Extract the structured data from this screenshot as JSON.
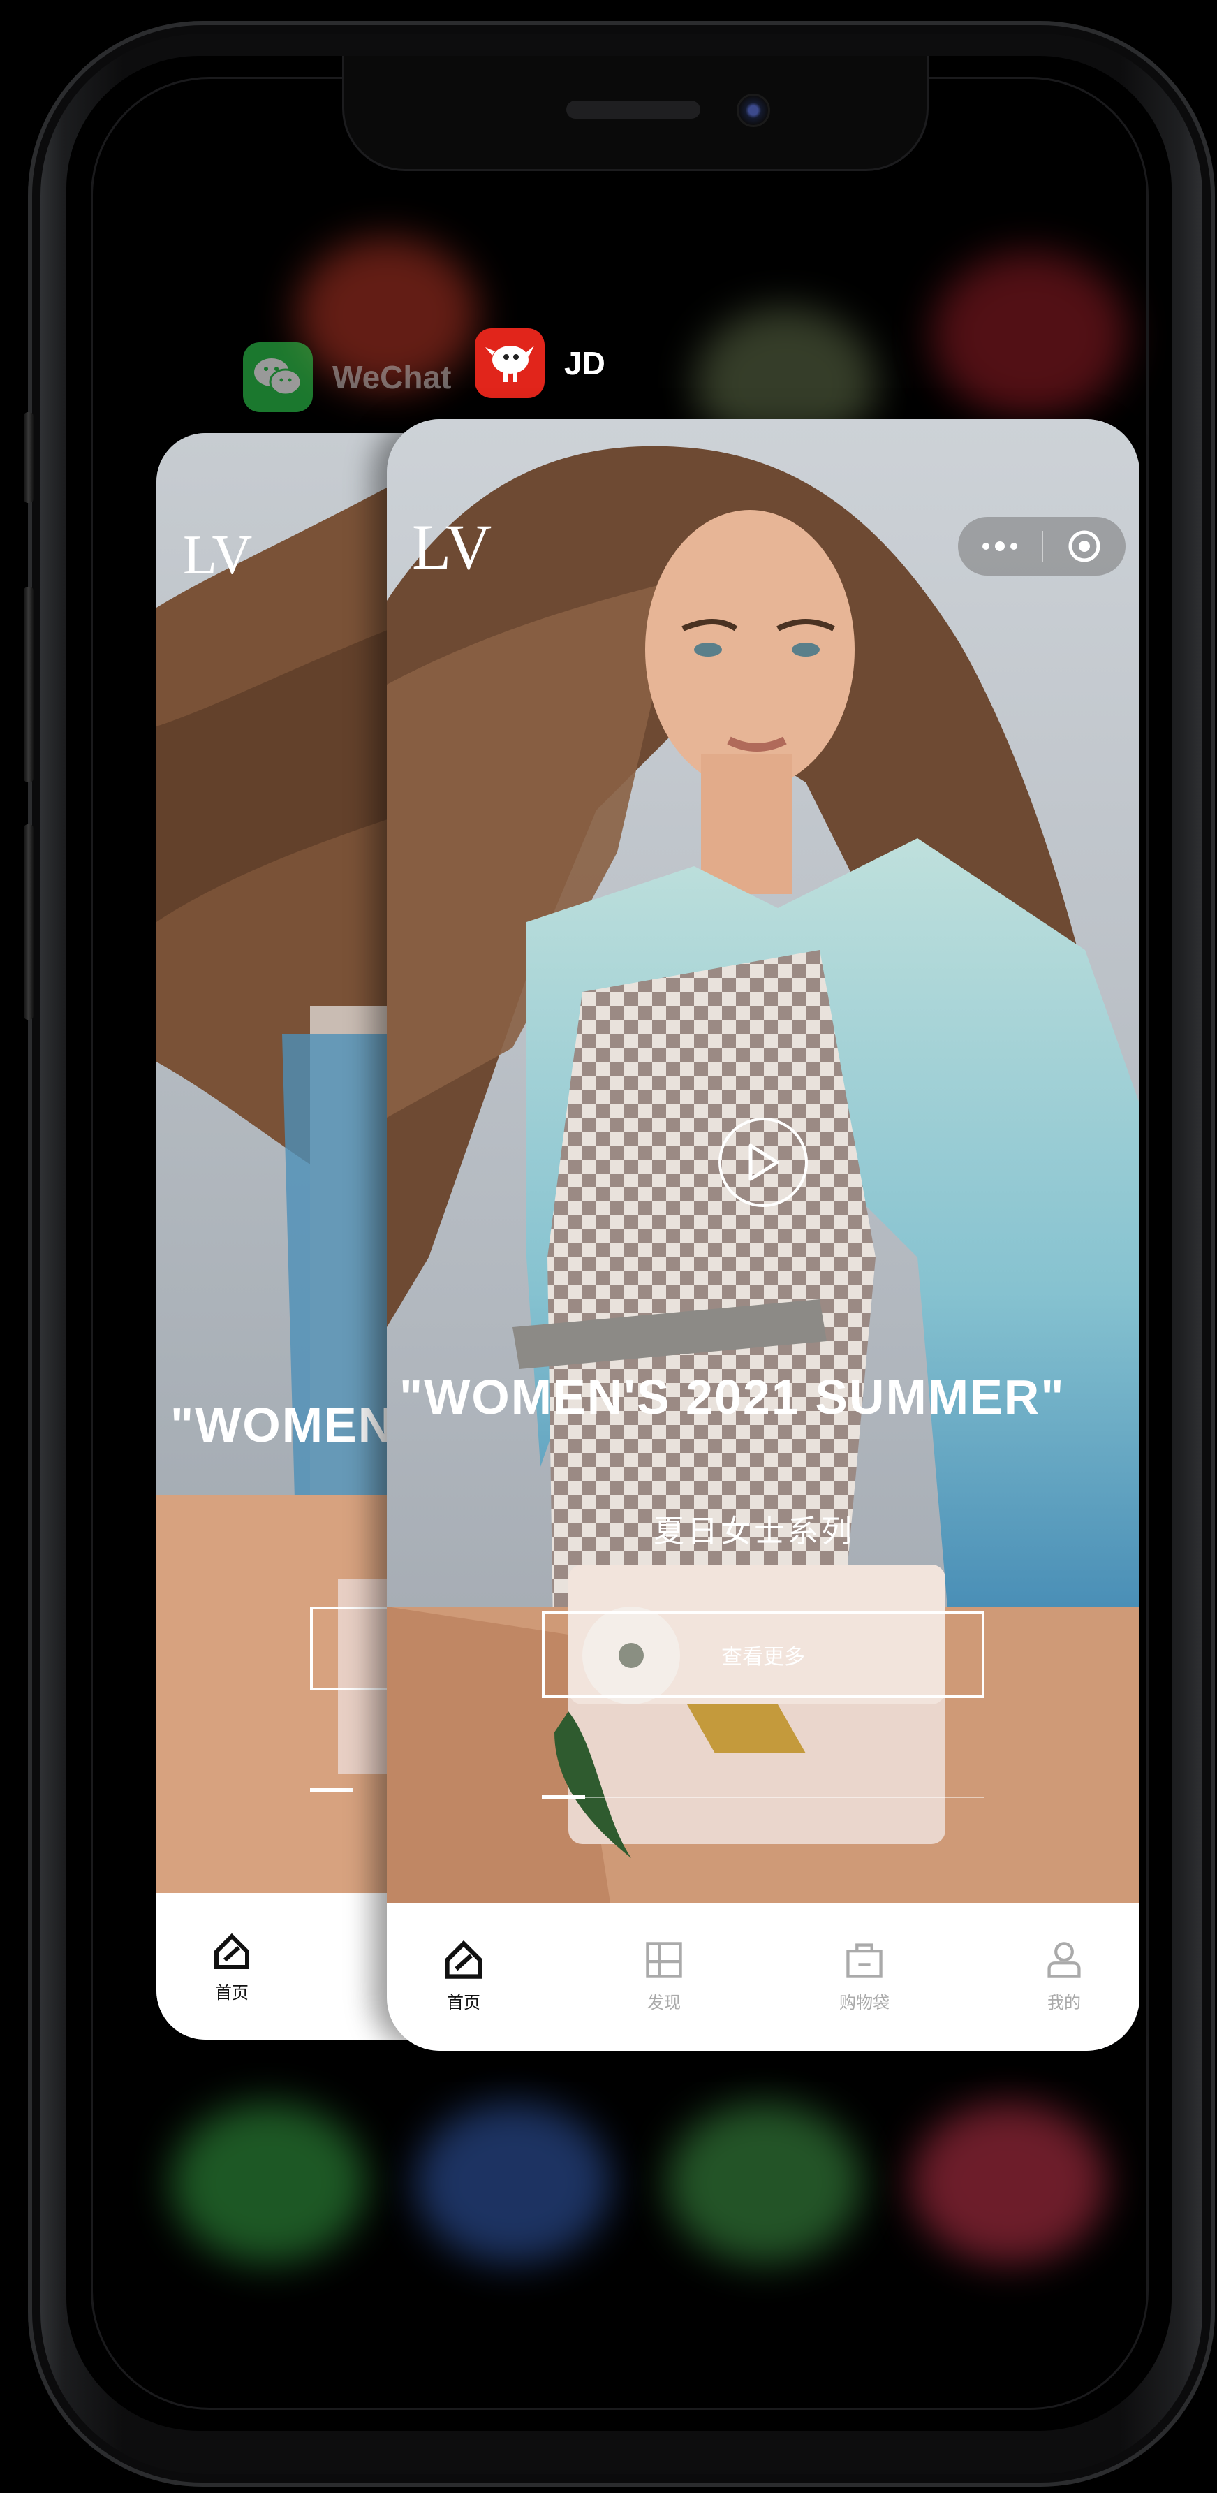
{
  "app_switcher": {
    "apps": [
      {
        "name": "WeChat",
        "icon": "wechat-icon",
        "icon_color": "#2dc84d"
      },
      {
        "name": "JD",
        "icon": "jd-mascot-icon",
        "icon_color": "#e1251b"
      }
    ]
  },
  "lv_app": {
    "logo": "LV",
    "hero_title": "\"WOMEN'S 2021 SUMMER\"",
    "hero_title_partial": "\"WOMEN",
    "hero_subtitle": "夏日女士系列",
    "cta_label": "查看更多",
    "tabs": [
      {
        "label": "首页",
        "icon": "home-icon",
        "active": true
      },
      {
        "label": "发现",
        "icon": "discover-grid-icon",
        "active": false
      },
      {
        "label": "购物袋",
        "icon": "shopping-bag-icon",
        "active": false
      },
      {
        "label": "我的",
        "icon": "user-icon",
        "active": false
      }
    ],
    "back_card_tab": {
      "label": "首页",
      "icon": "home-icon"
    }
  }
}
